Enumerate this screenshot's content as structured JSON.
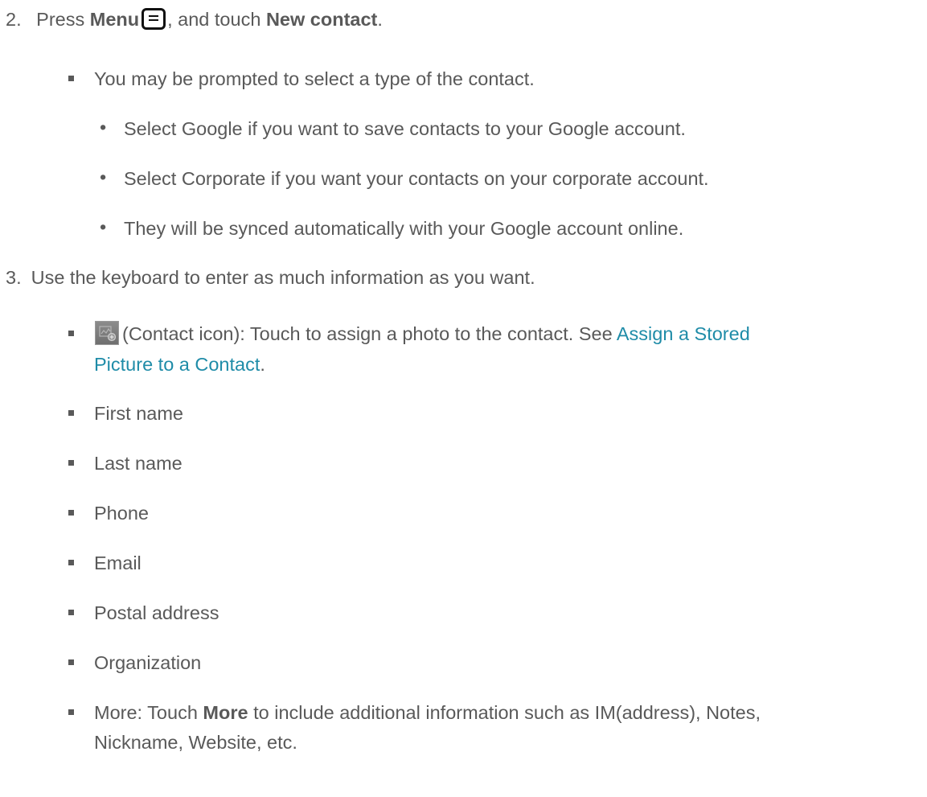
{
  "step2": {
    "number": "2.",
    "press": "Press ",
    "menu": "Menu",
    "mid": ", and touch ",
    "new_contact": "New contact",
    "end": "."
  },
  "prompt": "You may be prompted to select a type of the contact.",
  "sub_bullets": [
    "Select Google if you want to save contacts to your Google account.",
    "Select Corporate if you want your contacts on your corporate account.",
    "They will be synced automatically with your Google account online."
  ],
  "step3": {
    "number": "3.",
    "text": "Use the keyboard to enter as much information as you want."
  },
  "contact_icon_item": {
    "text": " (Contact icon): Touch to assign a photo to the contact. See ",
    "link_line1": "Assign a Stored",
    "link_line2": "Picture to a Contact",
    "end": "."
  },
  "fields": [
    "First name",
    "Last name",
    "Phone",
    "Email",
    "Postal address",
    "Organization"
  ],
  "more_item": {
    "prefix": "More: Touch ",
    "bold": "More",
    "suffix": " to include additional information such as IM(address), Notes,",
    "line2": "Nickname, Website, etc."
  },
  "colors": {
    "text": "#595959",
    "link": "#1f8ca8"
  },
  "icons": [
    "menu-key-icon",
    "contact-photo-icon"
  ]
}
